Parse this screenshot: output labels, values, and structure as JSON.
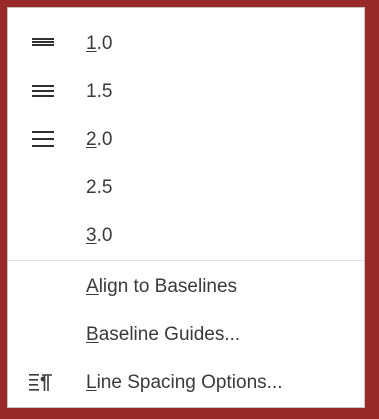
{
  "menu": {
    "spacing_items": [
      {
        "accel": "1",
        "rest": ".0"
      },
      {
        "accel": "",
        "rest": "1.5"
      },
      {
        "accel": "2",
        "rest": ".0"
      },
      {
        "accel": "",
        "rest": "2.5"
      },
      {
        "accel": "3",
        "rest": ".0"
      }
    ],
    "align_baselines": {
      "accel": "A",
      "rest": "lign to Baselines"
    },
    "baseline_guides": {
      "accel": "B",
      "rest": "aseline Guides..."
    },
    "line_spacing_options": {
      "accel": "L",
      "rest": "ine Spacing Options..."
    }
  },
  "icons": {
    "spacing_1_0": "line-spacing-1.0-icon",
    "spacing_1_5": "line-spacing-1.5-icon",
    "spacing_2_0": "line-spacing-2.0-icon",
    "line_spacing_options": "line-spacing-options-icon"
  },
  "colors": {
    "frame": "#9a2a2a",
    "text": "#3a3a3a",
    "separator": "#e3e3e3"
  }
}
